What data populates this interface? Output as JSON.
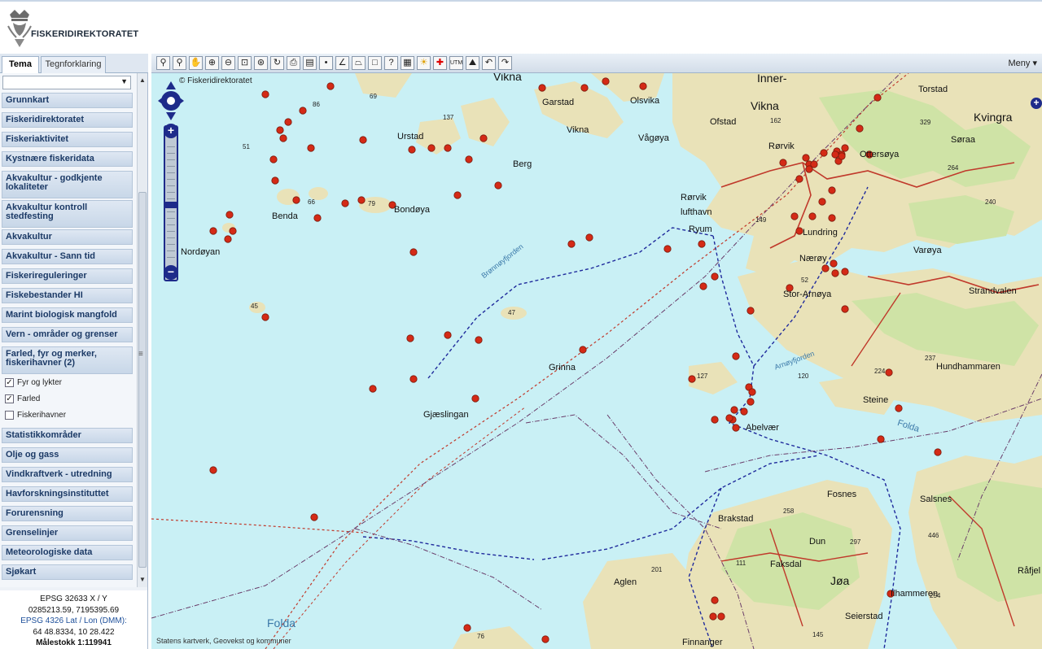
{
  "header": {
    "logo_text": "FISKERIDIREKTORATET"
  },
  "sidebar": {
    "tabs": [
      {
        "label": "Tema",
        "active": true
      },
      {
        "label": "Tegnforklaring",
        "active": false
      }
    ],
    "categories": [
      "Grunnkart",
      "Fiskeridirektoratet",
      "Fiskeriaktivitet",
      "Kystnære fiskeridata",
      "Akvakultur - godkjente lokaliteter",
      "Akvakultur kontroll stedfesting",
      "Akvakultur",
      "Akvakultur - Sann tid",
      "Fiskerireguleringer",
      "Fiskebestander HI",
      "Marint biologisk mangfold",
      "Vern - områder og grenser",
      "Farled, fyr og merker, fiskerihavner (2)",
      "Statistikkområder",
      "Olje og gass",
      "Vindkraftverk - utredning",
      "Havforskningsinstituttet",
      "Forurensning",
      "Grenselinjer",
      "Meteorologiske data",
      "Sjøkart"
    ],
    "sublayers": [
      {
        "label": "Fyr og lykter",
        "checked": true
      },
      {
        "label": "Farled",
        "checked": true
      },
      {
        "label": "Fiskerihavner",
        "checked": false
      }
    ],
    "info_icon": "i"
  },
  "coords": {
    "utm_label": "EPSG 32633 X / Y",
    "utm_value": "0285213.59, 7195395.69",
    "latlon_label": "EPSG 4326 Lat / Lon (DMM):",
    "latlon_value": "64 48.8334, 10 28.422",
    "scale": "Målestokk 1:119941"
  },
  "toolbar": {
    "menu_label": "Meny ▾",
    "tool_icons": [
      "binoculars-icon",
      "binoculars2-icon",
      "hand-pan-icon",
      "zoom-in-icon",
      "zoom-out-icon",
      "zoom-box-icon",
      "zoom-scale-icon",
      "refresh-icon",
      "print-icon",
      "save-map-icon",
      "point-icon",
      "line-icon",
      "polygon-icon",
      "rectangle-icon",
      "identify-icon",
      "legend-icon",
      "sun-icon",
      "first-aid-icon",
      "utm-icon",
      "profile-icon",
      "undo-icon",
      "redo-icon"
    ]
  },
  "map": {
    "copyright": "© Fiskeridirektoratet",
    "attribution": "Statens kartverk, Geovekst og kommuner",
    "place_labels": [
      {
        "text": "Vikna",
        "big": true
      },
      {
        "text": "Inner-",
        "big": true
      },
      {
        "text": "Vikna",
        "big": true
      },
      {
        "text": "Kvingra",
        "big": true
      },
      {
        "text": "Garstad"
      },
      {
        "text": "Olsvika"
      },
      {
        "text": "Torstad"
      },
      {
        "text": "Ofstad"
      },
      {
        "text": "Vikna"
      },
      {
        "text": "Vågøya"
      },
      {
        "text": "Rørvik"
      },
      {
        "text": "Ottersøya"
      },
      {
        "text": "Søraa"
      },
      {
        "text": "Urstad"
      },
      {
        "text": "Berg"
      },
      {
        "text": "Benda"
      },
      {
        "text": "Bondøya"
      },
      {
        "text": "Nordøyan"
      },
      {
        "text": "Rørvik lufthavn"
      },
      {
        "text": "Ryum"
      },
      {
        "text": "Lundring"
      },
      {
        "text": "Nærøy"
      },
      {
        "text": "Varøya"
      },
      {
        "text": "Stor-Arnøya"
      },
      {
        "text": "Strandvalen"
      },
      {
        "text": "Grinna"
      },
      {
        "text": "Gjæslingan"
      },
      {
        "text": "Hundhammaren"
      },
      {
        "text": "Steine"
      },
      {
        "text": "Abelvær"
      },
      {
        "text": "Fosnes"
      },
      {
        "text": "Salsnes"
      },
      {
        "text": "Brakstad"
      },
      {
        "text": "Dun"
      },
      {
        "text": "Faksdal"
      },
      {
        "text": "Jøa",
        "big": true
      },
      {
        "text": "Aglen"
      },
      {
        "text": "Ilhammeren"
      },
      {
        "text": "Seierstad"
      },
      {
        "text": "Finnanger"
      },
      {
        "text": "Råfjel"
      },
      {
        "text": "Folda",
        "blue": true,
        "big": true
      },
      {
        "text": "Folda",
        "blue": true
      },
      {
        "text": "Brønnøyfjorden",
        "blue": true
      },
      {
        "text": "Arnøyfjorden",
        "blue": true
      }
    ],
    "elevation_labels": [
      "69",
      "86",
      "137",
      "51",
      "66",
      "79",
      "162",
      "329",
      "264",
      "240",
      "149",
      "52",
      "47",
      "45",
      "127",
      "120",
      "224",
      "237",
      "258",
      "297",
      "111",
      "201",
      "446",
      "254",
      "145",
      "76"
    ],
    "colors": {
      "sea": "#c9f0f5",
      "land": "#e9e2b8",
      "forest": "#cfe3a6",
      "road": "#c0392b",
      "marker": "#d42a16",
      "fairway": "#1f2a9c",
      "boundary": "#6a3d6a"
    }
  }
}
